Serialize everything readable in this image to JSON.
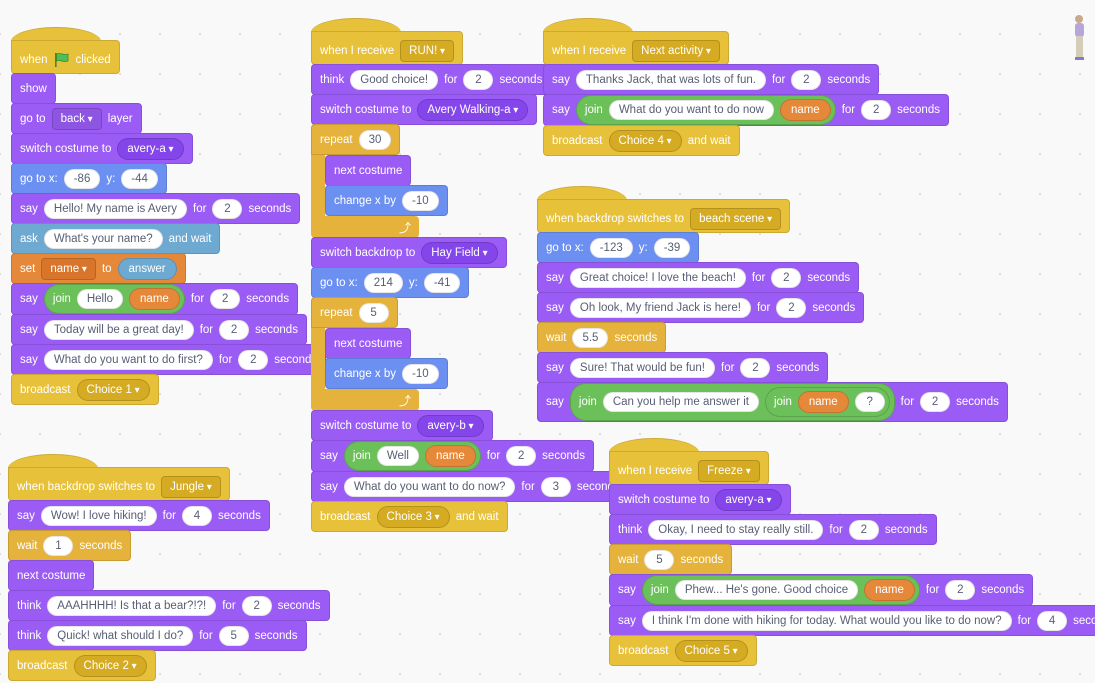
{
  "colors": {
    "looks": "#9b5cf6",
    "motion": "#6c90f2",
    "events": "#e8c13b",
    "control": "#e5b23b",
    "sensing": "#6ea9d1",
    "variables": "#e6883a",
    "operators": "#6cc05a"
  },
  "scripts": [
    {
      "blocks": [
        {
          "cat": "events",
          "hat": true,
          "parts": [
            {
              "t": "when"
            },
            {
              "icon": "green-flag"
            },
            {
              "t": "clicked"
            }
          ]
        },
        {
          "cat": "looks",
          "parts": [
            {
              "t": "show"
            }
          ]
        },
        {
          "cat": "looks",
          "parts": [
            {
              "t": "go to"
            },
            {
              "box": "back"
            },
            {
              "t": "layer"
            }
          ]
        },
        {
          "cat": "looks",
          "parts": [
            {
              "t": "switch costume to"
            },
            {
              "dd": "avery-a"
            }
          ]
        },
        {
          "cat": "motion",
          "parts": [
            {
              "t": "go to x:"
            },
            {
              "in": "-86"
            },
            {
              "t": "y:"
            },
            {
              "in": "-44"
            }
          ]
        },
        {
          "cat": "looks",
          "parts": [
            {
              "t": "say"
            },
            {
              "in": "Hello! My name is Avery"
            },
            {
              "t": "for"
            },
            {
              "in": "2"
            },
            {
              "t": "seconds"
            }
          ]
        },
        {
          "cat": "sensing",
          "parts": [
            {
              "t": "ask"
            },
            {
              "in": "What's your name?"
            },
            {
              "t": "and wait"
            }
          ]
        },
        {
          "cat": "variables",
          "parts": [
            {
              "t": "set"
            },
            {
              "box": "name"
            },
            {
              "t": "to"
            },
            {
              "sens": "answer"
            }
          ]
        },
        {
          "cat": "looks",
          "parts": [
            {
              "t": "say"
            },
            {
              "join": [
                {
                  "t": "join"
                },
                {
                  "in": "Hello"
                },
                {
                  "var": "name"
                }
              ]
            },
            {
              "t": "for"
            },
            {
              "in": "2"
            },
            {
              "t": "seconds"
            }
          ]
        },
        {
          "cat": "looks",
          "parts": [
            {
              "t": "say"
            },
            {
              "in": "Today will be a great day!"
            },
            {
              "t": "for"
            },
            {
              "in": "2"
            },
            {
              "t": "seconds"
            }
          ]
        },
        {
          "cat": "looks",
          "parts": [
            {
              "t": "say"
            },
            {
              "in": "What do you want to do first?"
            },
            {
              "t": "for"
            },
            {
              "in": "2"
            },
            {
              "t": "seconds"
            }
          ]
        },
        {
          "cat": "events",
          "parts": [
            {
              "t": "broadcast"
            },
            {
              "dd": "Choice 1"
            }
          ]
        }
      ]
    },
    {
      "blocks": [
        {
          "cat": "events",
          "hat": true,
          "parts": [
            {
              "t": "when backdrop switches to"
            },
            {
              "box": "Jungle"
            }
          ]
        },
        {
          "cat": "looks",
          "parts": [
            {
              "t": "say"
            },
            {
              "in": "Wow! I love hiking!"
            },
            {
              "t": "for"
            },
            {
              "in": "4"
            },
            {
              "t": "seconds"
            }
          ]
        },
        {
          "cat": "control",
          "parts": [
            {
              "t": "wait"
            },
            {
              "in": "1"
            },
            {
              "t": "seconds"
            }
          ]
        },
        {
          "cat": "looks",
          "parts": [
            {
              "t": "next costume"
            }
          ]
        },
        {
          "cat": "looks",
          "parts": [
            {
              "t": "think"
            },
            {
              "in": "AAAHHHH! Is that a bear?!?!"
            },
            {
              "t": "for"
            },
            {
              "in": "2"
            },
            {
              "t": "seconds"
            }
          ]
        },
        {
          "cat": "looks",
          "parts": [
            {
              "t": "think"
            },
            {
              "in": "Quick! what should I do?"
            },
            {
              "t": "for"
            },
            {
              "in": "5"
            },
            {
              "t": "seconds"
            }
          ]
        },
        {
          "cat": "events",
          "parts": [
            {
              "t": "broadcast"
            },
            {
              "dd": "Choice 2"
            }
          ]
        }
      ]
    },
    {
      "blocks": [
        {
          "cat": "events",
          "hat": true,
          "parts": [
            {
              "t": "when I receive"
            },
            {
              "box": "RUN!"
            }
          ]
        },
        {
          "cat": "looks",
          "parts": [
            {
              "t": "think"
            },
            {
              "in": "Good choice!"
            },
            {
              "t": "for"
            },
            {
              "in": "2"
            },
            {
              "t": "seconds"
            }
          ]
        },
        {
          "cat": "looks",
          "parts": [
            {
              "t": "switch costume to"
            },
            {
              "dd": "Avery Walking-a"
            }
          ]
        },
        {
          "cat": "control",
          "c": true,
          "parts": [
            {
              "t": "repeat"
            },
            {
              "in": "30"
            }
          ],
          "inner": [
            {
              "cat": "looks",
              "parts": [
                {
                  "t": "next costume"
                }
              ]
            },
            {
              "cat": "motion",
              "parts": [
                {
                  "t": "change x by"
                },
                {
                  "in": "-10"
                }
              ]
            }
          ]
        },
        {
          "cat": "looks",
          "parts": [
            {
              "t": "switch backdrop to"
            },
            {
              "dd": "Hay Field"
            }
          ]
        },
        {
          "cat": "motion",
          "parts": [
            {
              "t": "go to x:"
            },
            {
              "in": "214"
            },
            {
              "t": "y:"
            },
            {
              "in": "-41"
            }
          ]
        },
        {
          "cat": "control",
          "c": true,
          "parts": [
            {
              "t": "repeat"
            },
            {
              "in": "5"
            }
          ],
          "inner": [
            {
              "cat": "looks",
              "parts": [
                {
                  "t": "next costume"
                }
              ]
            },
            {
              "cat": "motion",
              "parts": [
                {
                  "t": "change x by"
                },
                {
                  "in": "-10"
                }
              ]
            }
          ]
        },
        {
          "cat": "looks",
          "parts": [
            {
              "t": "switch costume to"
            },
            {
              "dd": "avery-b"
            }
          ]
        },
        {
          "cat": "looks",
          "parts": [
            {
              "t": "say"
            },
            {
              "join": [
                {
                  "t": "join"
                },
                {
                  "in": "Well"
                },
                {
                  "var": "name"
                }
              ]
            },
            {
              "t": "for"
            },
            {
              "in": "2"
            },
            {
              "t": "seconds"
            }
          ]
        },
        {
          "cat": "looks",
          "parts": [
            {
              "t": "say"
            },
            {
              "in": "What do you want to do now?"
            },
            {
              "t": "for"
            },
            {
              "in": "3"
            },
            {
              "t": "seconds"
            }
          ]
        },
        {
          "cat": "events",
          "parts": [
            {
              "t": "broadcast"
            },
            {
              "dd": "Choice 3"
            },
            {
              "t": "and wait"
            }
          ]
        }
      ]
    },
    {
      "blocks": [
        {
          "cat": "events",
          "hat": true,
          "parts": [
            {
              "t": "when I receive"
            },
            {
              "box": "Next activity"
            }
          ]
        },
        {
          "cat": "looks",
          "parts": [
            {
              "t": "say"
            },
            {
              "in": "Thanks Jack, that was lots of fun."
            },
            {
              "t": "for"
            },
            {
              "in": "2"
            },
            {
              "t": "seconds"
            }
          ]
        },
        {
          "cat": "looks",
          "parts": [
            {
              "t": "say"
            },
            {
              "join": [
                {
                  "t": "join"
                },
                {
                  "in": "What do you want to do now"
                },
                {
                  "var": "name"
                }
              ]
            },
            {
              "t": "for"
            },
            {
              "in": "2"
            },
            {
              "t": "seconds"
            }
          ]
        },
        {
          "cat": "events",
          "parts": [
            {
              "t": "broadcast"
            },
            {
              "dd": "Choice 4"
            },
            {
              "t": "and wait"
            }
          ]
        }
      ]
    },
    {
      "blocks": [
        {
          "cat": "events",
          "hat": true,
          "parts": [
            {
              "t": "when backdrop switches to"
            },
            {
              "box": "beach scene"
            }
          ]
        },
        {
          "cat": "motion",
          "parts": [
            {
              "t": "go to x:"
            },
            {
              "in": "-123"
            },
            {
              "t": "y:"
            },
            {
              "in": "-39"
            }
          ]
        },
        {
          "cat": "looks",
          "parts": [
            {
              "t": "say"
            },
            {
              "in": "Great choice! I love the beach!"
            },
            {
              "t": "for"
            },
            {
              "in": "2"
            },
            {
              "t": "seconds"
            }
          ]
        },
        {
          "cat": "looks",
          "parts": [
            {
              "t": "say"
            },
            {
              "in": "Oh look, My friend Jack is here!"
            },
            {
              "t": "for"
            },
            {
              "in": "2"
            },
            {
              "t": "seconds"
            }
          ]
        },
        {
          "cat": "control",
          "parts": [
            {
              "t": "wait"
            },
            {
              "in": "5.5"
            },
            {
              "t": "seconds"
            }
          ]
        },
        {
          "cat": "looks",
          "parts": [
            {
              "t": "say"
            },
            {
              "in": "Sure! That would be fun!"
            },
            {
              "t": "for"
            },
            {
              "in": "2"
            },
            {
              "t": "seconds"
            }
          ]
        },
        {
          "cat": "looks",
          "parts": [
            {
              "t": "say"
            },
            {
              "join": [
                {
                  "t": "join"
                },
                {
                  "in": "Can you help me answer it"
                },
                {
                  "join": [
                    {
                      "t": "join"
                    },
                    {
                      "var": "name"
                    },
                    {
                      "in": "?"
                    }
                  ]
                }
              ]
            },
            {
              "t": "for"
            },
            {
              "in": "2"
            },
            {
              "t": "seconds"
            }
          ]
        }
      ]
    },
    {
      "blocks": [
        {
          "cat": "events",
          "hat": true,
          "parts": [
            {
              "t": "when I receive"
            },
            {
              "box": "Freeze"
            }
          ]
        },
        {
          "cat": "looks",
          "parts": [
            {
              "t": "switch costume to"
            },
            {
              "dd": "avery-a"
            }
          ]
        },
        {
          "cat": "looks",
          "parts": [
            {
              "t": "think"
            },
            {
              "in": "Okay, I need to stay really still."
            },
            {
              "t": "for"
            },
            {
              "in": "2"
            },
            {
              "t": "seconds"
            }
          ]
        },
        {
          "cat": "control",
          "parts": [
            {
              "t": "wait"
            },
            {
              "in": "5"
            },
            {
              "t": "seconds"
            }
          ]
        },
        {
          "cat": "looks",
          "parts": [
            {
              "t": "say"
            },
            {
              "join": [
                {
                  "t": "join"
                },
                {
                  "in": "Phew... He's gone. Good choice"
                },
                {
                  "var": "name"
                }
              ]
            },
            {
              "t": "for"
            },
            {
              "in": "2"
            },
            {
              "t": "seconds"
            }
          ]
        },
        {
          "cat": "looks",
          "parts": [
            {
              "t": "say"
            },
            {
              "in": "I think I'm done with hiking for today. What would you like to do now?"
            },
            {
              "t": "for"
            },
            {
              "in": "4"
            },
            {
              "t": "seconds"
            }
          ]
        },
        {
          "cat": "events",
          "parts": [
            {
              "t": "broadcast"
            },
            {
              "dd": "Choice 5"
            }
          ]
        }
      ]
    }
  ],
  "sprite_icon": "sprite-avery-thumbnail"
}
